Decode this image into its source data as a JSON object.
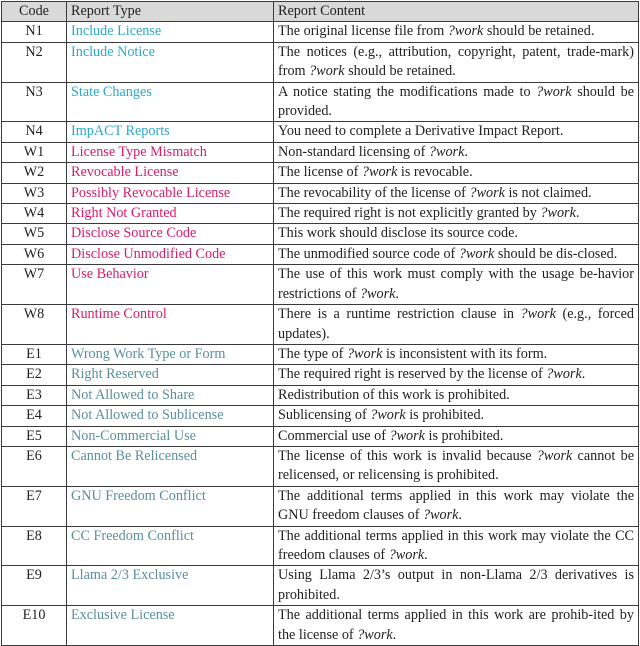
{
  "table": {
    "headers": [
      "Code",
      "Report Type",
      "Report Content"
    ],
    "colors": {
      "notice": "#2aa9c9",
      "warning": "#d81b6a",
      "error": "#5a8f9a",
      "header_bg": "#d9d9d9"
    },
    "rows": [
      {
        "code": "N1",
        "type": "Include License",
        "category": "notice",
        "content": "The original license file from *?work* should be retained."
      },
      {
        "code": "N2",
        "type": "Include Notice",
        "category": "notice",
        "content": "The notices (e.g., attribution, copyright, patent, trade-mark) from *?work* should be retained."
      },
      {
        "code": "N3",
        "type": "State Changes",
        "category": "notice",
        "content": "A notice stating the modifications made to *?work* should be provided."
      },
      {
        "code": "N4",
        "type": "ImpACT Reports",
        "category": "notice",
        "content": "You need to complete a Derivative Impact Report."
      },
      {
        "code": "W1",
        "type": "License Type Mismatch",
        "category": "warning",
        "content": "Non-standard licensing of *?work*."
      },
      {
        "code": "W2",
        "type": "Revocable License",
        "category": "warning",
        "content": "The license of *?work* is revocable."
      },
      {
        "code": "W3",
        "type": "Possibly Revocable License",
        "category": "warning",
        "content": "The revocability of the license of *?work* is not claimed."
      },
      {
        "code": "W4",
        "type": "Right Not Granted",
        "category": "warning",
        "content": "The required right is not explicitly granted by *?work*."
      },
      {
        "code": "W5",
        "type": "Disclose Source Code",
        "category": "warning",
        "content": "This work should disclose its source code."
      },
      {
        "code": "W6",
        "type": "Disclose Unmodified Code",
        "category": "warning",
        "content": "The unmodified source code of *?work* should be dis-closed."
      },
      {
        "code": "W7",
        "type": "Use Behavior",
        "category": "warning",
        "content": "The use of this work must comply with the usage be-havior restrictions of *?work*."
      },
      {
        "code": "W8",
        "type": "Runtime Control",
        "category": "warning",
        "content": "There is a runtime restriction clause in *?work* (e.g., forced updates)."
      },
      {
        "code": "E1",
        "type": "Wrong Work Type or Form",
        "category": "error",
        "content": "The type of *?work* is inconsistent with its form."
      },
      {
        "code": "E2",
        "type": "Right Reserved",
        "category": "error",
        "content": "The required right is reserved by the license of *?work*."
      },
      {
        "code": "E3",
        "type": "Not Allowed to Share",
        "category": "error",
        "content": "Redistribution of this work is prohibited."
      },
      {
        "code": "E4",
        "type": "Not Allowed to Sublicense",
        "category": "error",
        "content": "Sublicensing of *?work* is prohibited."
      },
      {
        "code": "E5",
        "type": "Non-Commercial Use",
        "category": "error",
        "content": "Commercial use of *?work* is prohibited."
      },
      {
        "code": "E6",
        "type": "Cannot Be Relicensed",
        "category": "error",
        "content": "The license of this work is invalid because *?work* cannot be relicensed, or relicensing is prohibited."
      },
      {
        "code": "E7",
        "type": "GNU Freedom Conflict",
        "category": "error",
        "content": "The additional terms applied in this work may violate the GNU freedom clauses of *?work*."
      },
      {
        "code": "E8",
        "type": "CC Freedom Conflict",
        "category": "error",
        "content": "The additional terms applied in this work may violate the CC freedom clauses of *?work*."
      },
      {
        "code": "E9",
        "type": "Llama 2/3 Exclusive",
        "category": "error",
        "content": "Using Llama 2/3’s output in non-Llama 2/3 derivatives is prohibited."
      },
      {
        "code": "E10",
        "type": "Exclusive License",
        "category": "error",
        "content": "The additional terms applied in this work are prohib-ited by the license of *?work*."
      }
    ]
  }
}
